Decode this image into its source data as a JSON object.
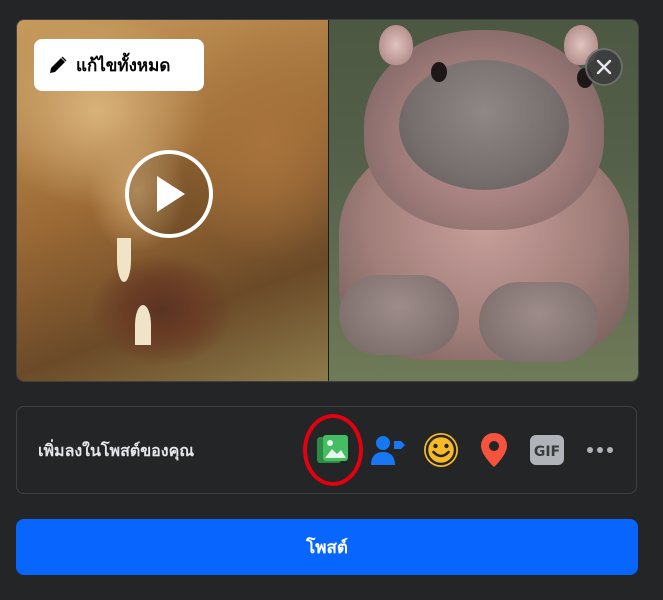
{
  "media": {
    "edit_all_label": "แก้ไขทั้งหมด"
  },
  "add_to_post": {
    "label": "เพิ่มลงในโพสต์ของคุณ",
    "gif_label": "GIF"
  },
  "post_button_label": "โพสต์",
  "colors": {
    "accent": "#0866ff",
    "photo_green": "#45bd62",
    "tag_blue": "#1877f2",
    "feeling_yellow": "#f7b928",
    "location_red": "#f5533d",
    "highlight_red": "#e3000f"
  }
}
